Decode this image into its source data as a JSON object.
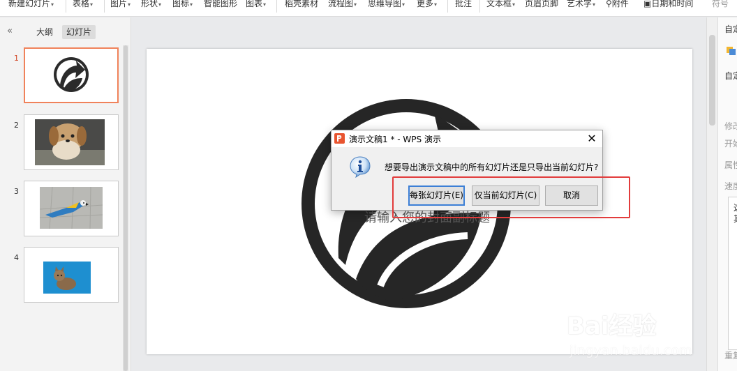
{
  "ribbon": {
    "items": [
      "新建幻灯片",
      "表格",
      "图片",
      "形状",
      "图标",
      "智能图形",
      "图表",
      "稻壳素材",
      "流程图",
      "思维导图",
      "更多",
      "批注",
      "文本框",
      "页眉页脚",
      "艺术字",
      "附件",
      "日期和时间",
      "符号"
    ]
  },
  "left_panel": {
    "collapse_glyph": "«",
    "tabs": {
      "outline": "大纲",
      "slides": "幻灯片"
    },
    "thumbnails": [
      {
        "number": "1",
        "content": "recycle-logo"
      },
      {
        "number": "2",
        "content": "dog-photo"
      },
      {
        "number": "3",
        "content": "parrot-photo"
      },
      {
        "number": "4",
        "content": "kitten-photo"
      }
    ]
  },
  "slide": {
    "subtitle_placeholder": "请输入您的封面副标题"
  },
  "right_panel": {
    "labels": [
      "自定",
      "自定",
      "修改",
      "开始",
      "属性",
      "速度",
      "这",
      "其",
      "重复"
    ]
  },
  "dialog": {
    "title": "演示文稿1 * - WPS 演示",
    "close_glyph": "✕",
    "message": "想要导出演示文稿中的所有幻灯片还是只导出当前幻灯片?",
    "buttons": {
      "each_slide": "每张幻灯片(E)",
      "current_slide": "仅当前幻灯片(C)",
      "cancel": "取消"
    }
  },
  "watermark": {
    "brand": "Bai经验",
    "url": "jingyan.baidu.com"
  },
  "colors": {
    "accent_orange": "#f0825a",
    "highlight_red": "#e23c3c",
    "primary_button_border": "#3c7fd6",
    "wps_logo": "#e8542f"
  }
}
